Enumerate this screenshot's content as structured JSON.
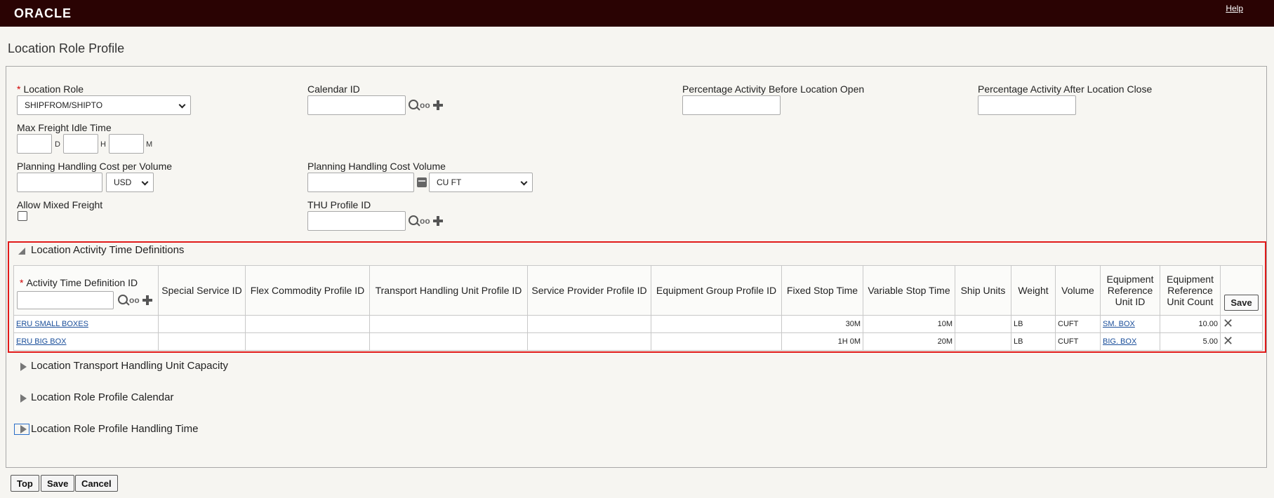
{
  "header": {
    "logo": "ORACLE",
    "help": "Help"
  },
  "page_title": "Location Role Profile",
  "form": {
    "location_role": {
      "label": "Location Role",
      "value": "SHIPFROM/SHIPTO"
    },
    "calendar_id": {
      "label": "Calendar ID",
      "value": ""
    },
    "pct_before_open": {
      "label": "Percentage Activity Before Location Open",
      "value": ""
    },
    "pct_after_close": {
      "label": "Percentage Activity After Location Close",
      "value": ""
    },
    "max_idle": {
      "label": "Max Freight Idle Time",
      "d": "D",
      "h": "H",
      "m": "M"
    },
    "handling_cost_per_volume": {
      "label": "Planning Handling Cost per Volume",
      "value": "",
      "currency": "USD"
    },
    "handling_cost_volume": {
      "label": "Planning Handling Cost Volume",
      "value": "",
      "uom": "CU FT"
    },
    "allow_mixed_freight": {
      "label": "Allow Mixed Freight",
      "checked": false
    },
    "thu_profile_id": {
      "label": "THU Profile ID",
      "value": ""
    }
  },
  "activity_section": {
    "title": "Location Activity Time Definitions",
    "columns": [
      "Activity Time Definition ID",
      "Special Service ID",
      "Flex Commodity Profile ID",
      "Transport Handling Unit Profile ID",
      "Service Provider Profile ID",
      "Equipment Group Profile ID",
      "Fixed Stop Time",
      "Variable Stop Time",
      "Ship Units",
      "Weight",
      "Volume",
      "Equipment Reference Unit ID",
      "Equipment Reference Unit Count"
    ],
    "save_label": "Save",
    "rows": [
      {
        "id": "ERU SMALL BOXES",
        "special": "",
        "flex": "",
        "thu": "",
        "sp": "",
        "eq": "",
        "fixed": "30M",
        "variable": "10M",
        "ship_units": "",
        "weight": "LB",
        "volume": "CUFT",
        "eru_id": "SM. BOX",
        "eru_count": "10.00"
      },
      {
        "id": "ERU BIG BOX",
        "special": "",
        "flex": "",
        "thu": "",
        "sp": "",
        "eq": "",
        "fixed": "1H 0M",
        "variable": "20M",
        "ship_units": "",
        "weight": "LB",
        "volume": "CUFT",
        "eru_id": "BIG. BOX",
        "eru_count": "5.00"
      }
    ]
  },
  "collapsed_sections": [
    "Location Transport Handling Unit Capacity",
    "Location Role Profile Calendar",
    "Location Role Profile Handling Time"
  ],
  "footer_buttons": {
    "top": "Top",
    "save": "Save",
    "cancel": "Cancel"
  },
  "icons": {
    "search": "search-icon",
    "view": "glasses-icon",
    "add": "plus-icon",
    "volume": "cube-icon",
    "delete": "x-icon"
  },
  "colors": {
    "header_bg": "#2a0303",
    "highlight_border": "#e11a1a",
    "link": "#1a4e9a"
  }
}
